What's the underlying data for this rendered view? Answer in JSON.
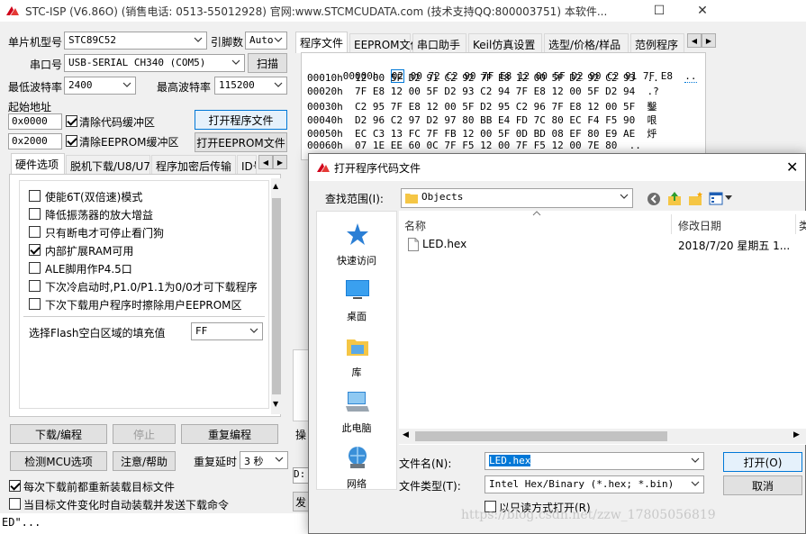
{
  "window": {
    "title": "STC-ISP (V6.86O) (销售电话: 0513-55012928) 官网:www.STCMCUDATA.com  (技术支持QQ:800003751) 本软件...",
    "minimize": "—",
    "maximize": "☐",
    "close": "✕"
  },
  "left": {
    "mcu_type_label": "单片机型号",
    "mcu_type_value": "STC89C52",
    "pin_label": "引脚数",
    "pin_value": "Auto",
    "port_label": "串口号",
    "port_value": "USB-SERIAL CH340 (COM5)",
    "scan_button": "扫描",
    "min_baud_label": "最低波特率",
    "min_baud_value": "2400",
    "max_baud_label": "最高波特率",
    "max_baud_value": "115200",
    "start_addr_label": "起始地址",
    "addr1_value": "0x0000",
    "clear_code_label": "清除代码缓冲区",
    "open_prog_button": "打开程序文件",
    "addr2_value": "0x2000",
    "clear_eeprom_label": "清除EEPROM缓冲区",
    "open_eeprom_button": "打开EEPROM文件"
  },
  "left_tabs": [
    "硬件选项",
    "脱机下载/U8/U7",
    "程序加密后传输",
    "ID号"
  ],
  "hw_options": [
    {
      "label": "使能6T(双倍速)模式",
      "checked": false
    },
    {
      "label": "降低振荡器的放大增益",
      "checked": false
    },
    {
      "label": "只有断电才可停止看门狗",
      "checked": false
    },
    {
      "label": "内部扩展RAM可用",
      "checked": true
    },
    {
      "label": "ALE脚用作P4.5口",
      "checked": false
    },
    {
      "label": "下次冷启动时,P1.0/P1.1为0/0才可下载程序",
      "checked": false
    },
    {
      "label": "下次下载用户程序时擦除用户EEPROM区",
      "checked": false
    }
  ],
  "fill": {
    "label": "选择Flash空白区域的填充值",
    "value": "FF"
  },
  "bottom": {
    "download_button": "下载/编程",
    "stop_button": "停止",
    "reprogram_button": "重复编程",
    "check_mcu_button": "检测MCU选项",
    "help_button": "注意/帮助",
    "repeat_delay_label": "重复延时",
    "repeat_delay_value": "3 秒",
    "reload_label": "每次下载前都重新装载目标文件",
    "auto_load_label": "当目标文件变化时自动装载并发送下载命令",
    "status_text": "ED\"..."
  },
  "right_tabs": [
    "程序文件",
    "EEPROM文件",
    "串口助手",
    "Keil仿真设置",
    "选型/价格/样品",
    "范例程序"
  ],
  "hex_rows": [
    {
      "addr": "00000h",
      "bytes": "02 00 72 C2 90 7F E8 12 00 5F D2 90 C2 91 7F E8",
      "ascii": ".."
    },
    {
      "addr": "00010h",
      "bytes": "12 00 5F D2 91 C2 92 7F E8 12 00 5F D2 92 C2 93",
      "ascii": ".."
    },
    {
      "addr": "00020h",
      "bytes": "7F E8 12 00 5F D2 93 C2 94 7F E8 12 00 5F D2 94",
      "ascii": ".?"
    },
    {
      "addr": "00030h",
      "bytes": "C2 95 7F E8 12 00 5F D2 95 C2 96 7F E8 12 00 5F",
      "ascii": "鑿"
    },
    {
      "addr": "00040h",
      "bytes": "D2 96 C2 97 D2 97 80 BB E4 FD 7C 80 EC F4 F5 90",
      "ascii": "哏"
    },
    {
      "addr": "00050h",
      "bytes": "EC C3 13 FC 7F FB 12 00 5F 0D BD 08 EF 80 E9 AE",
      "ascii": "烀"
    },
    {
      "addr": "00060h",
      "bytes": "07 1E EE 60 0C 7F F5 12 00 7F F5 12 00 7E 80",
      "ascii": ".."
    }
  ],
  "partial": {
    "op": "操",
    "d": "D:",
    "fa": "发"
  },
  "dialog": {
    "title": "打开程序代码文件",
    "lookin_label": "查找范围(I):",
    "lookin_value": "Objects",
    "places": [
      "快速访问",
      "桌面",
      "库",
      "此电脑",
      "网络"
    ],
    "col_name": "名称",
    "col_date": "修改日期",
    "col_more": "类",
    "file_name": "LED.hex",
    "file_date": "2018/7/20 星期五 1...",
    "filename_label": "文件名(N):",
    "filename_value": "LED.hex",
    "filetype_label": "文件类型(T):",
    "filetype_value": "Intel Hex/Binary (*.hex; *.bin)",
    "readonly_label": "以只读方式打开(R)",
    "open_button": "打开(O)",
    "cancel_button": "取消",
    "close": "✕"
  },
  "watermark": "https://blog.csdn.net/zzw_17805056819",
  "colors": {
    "accent": "#0078d7",
    "selection": "#0078d7"
  }
}
